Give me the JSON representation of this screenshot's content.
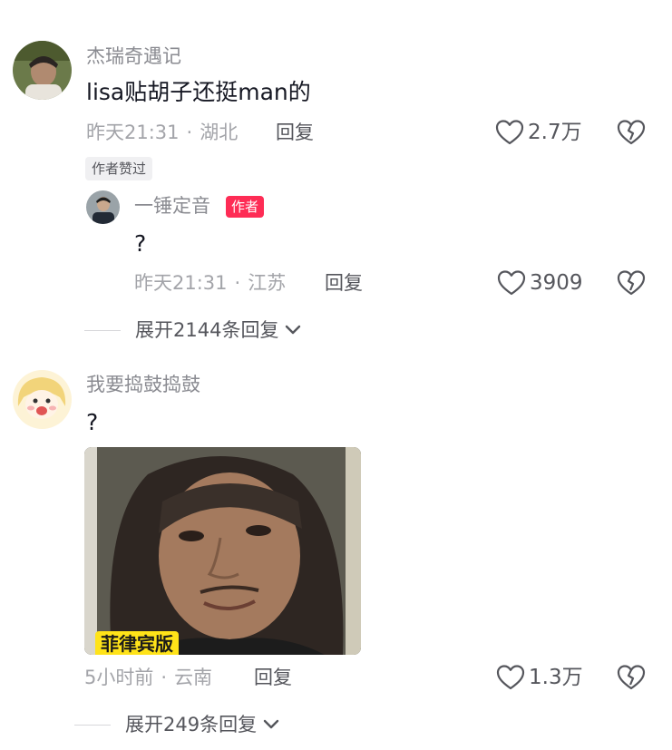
{
  "comments": [
    {
      "username": "杰瑞奇遇记",
      "content": "lisa贴胡子还挺man的",
      "time": "昨天21:31",
      "location": "湖北",
      "reply_label": "回复",
      "likes": "2.7万",
      "badge": "作者赞过",
      "avatar_icon": "user-avatar",
      "reply": {
        "username": "一锤定音",
        "author_badge": "作者",
        "content": "?",
        "time": "昨天21:31",
        "location": "江苏",
        "reply_label": "回复",
        "likes": "3909"
      },
      "expand_label": "展开2144条回复"
    },
    {
      "username": "我要捣鼓捣鼓",
      "content": "?",
      "image_caption": "菲律宾版",
      "time": "5小时前",
      "location": "云南",
      "reply_label": "回复",
      "likes": "1.3万",
      "expand_label": "展开249条回复"
    }
  ],
  "separator": "·",
  "colors": {
    "author_badge": "#fe2c55",
    "caption_bg": "#ffe319",
    "meta_text": "#a3a4a9"
  },
  "icons": [
    "heart-outline-icon",
    "broken-heart-icon",
    "chevron-down-icon"
  ]
}
